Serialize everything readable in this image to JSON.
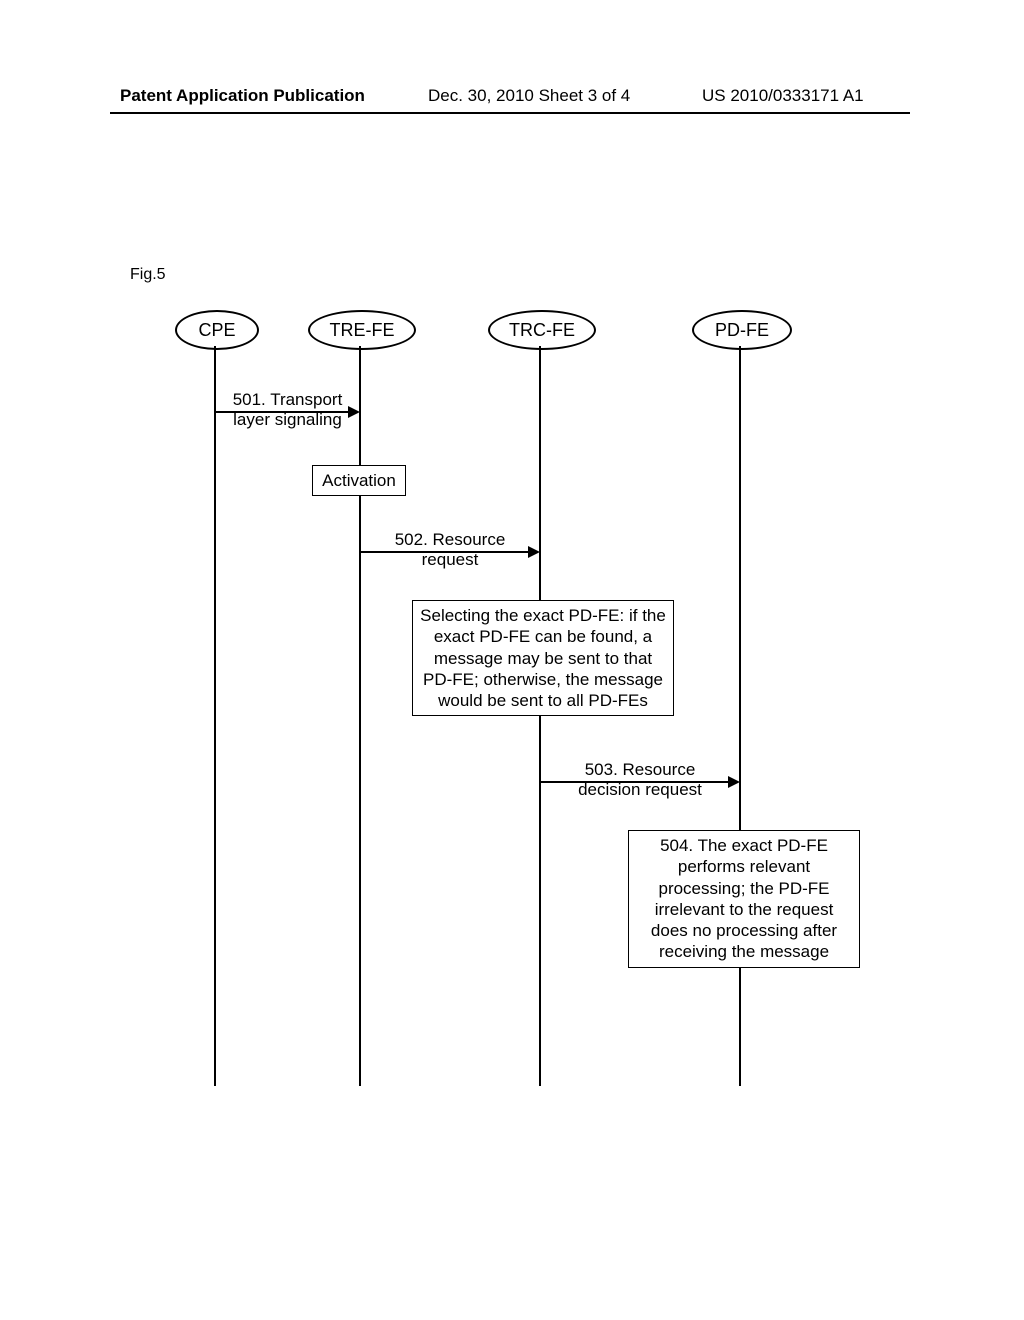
{
  "header": {
    "left": "Patent Application Publication",
    "mid": "Dec. 30, 2010  Sheet 3 of 4",
    "right": "US 2010/0333171 A1"
  },
  "fig_label": "Fig.5",
  "actors": {
    "cpe": "CPE",
    "trefe": "TRE-FE",
    "trcfe": "TRC-FE",
    "pdfe": "PD-FE"
  },
  "messages": {
    "m501": "501. Transport\nlayer signaling",
    "m502": "502. Resource\nrequest",
    "m503": "503. Resource\ndecision request"
  },
  "notes": {
    "activation": "Activation",
    "select": "Selecting the exact PD-FE:\nif the exact PD-FE can be\nfound, a message may be\nsent to that PD-FE;\notherwise, the message\nwould be sent to all PD-FEs",
    "process": "504. The exact PD-FE\nperforms relevant\nprocessing; the PD-FE\nirrelevant to the request\ndoes no processing after\nreceiving the message"
  }
}
